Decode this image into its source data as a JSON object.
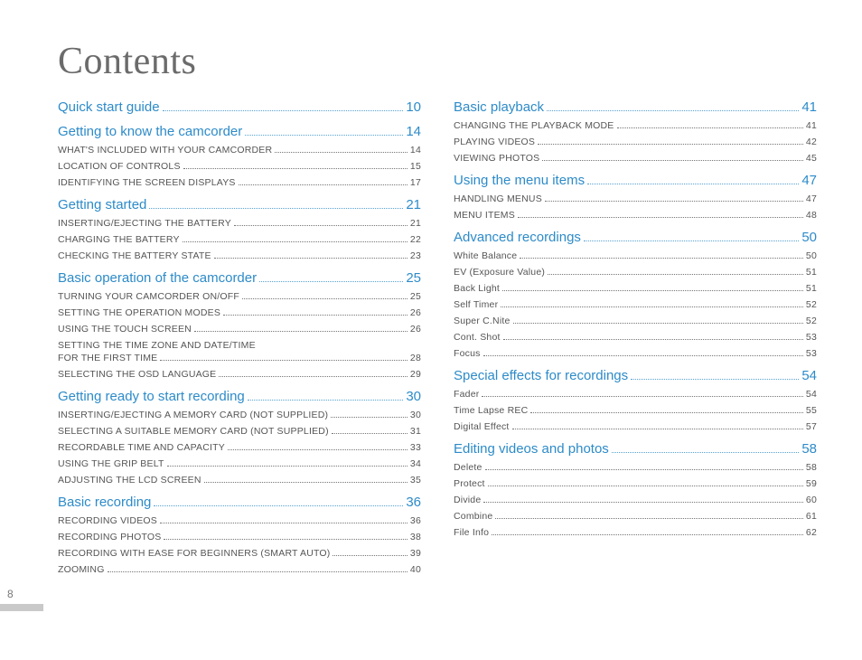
{
  "pageNumber": "8",
  "title": "Contents",
  "columns": [
    [
      {
        "type": "section",
        "label": "Quick start guide",
        "page": "10"
      },
      {
        "type": "section",
        "label": "Getting to know the camcorder",
        "page": "14"
      },
      {
        "type": "item",
        "label": "WHAT'S INCLUDED WITH YOUR CAMCORDER",
        "page": "14"
      },
      {
        "type": "item",
        "label": "LOCATION OF CONTROLS",
        "page": "15"
      },
      {
        "type": "item",
        "label": "IDENTIFYING THE SCREEN DISPLAYS",
        "page": "17"
      },
      {
        "type": "section",
        "label": "Getting started",
        "page": "21"
      },
      {
        "type": "item",
        "label": "INSERTING/EJECTING THE BATTERY",
        "page": "21"
      },
      {
        "type": "item",
        "label": "CHARGING THE BATTERY",
        "page": "22"
      },
      {
        "type": "item",
        "label": "CHECKING THE BATTERY STATE",
        "page": "23"
      },
      {
        "type": "section",
        "label": "Basic operation of the camcorder",
        "page": "25"
      },
      {
        "type": "item",
        "label": "TURNING YOUR CAMCORDER ON/OFF",
        "page": "25"
      },
      {
        "type": "item",
        "label": "SETTING THE OPERATION MODES",
        "page": "26"
      },
      {
        "type": "item",
        "label": "USING THE TOUCH SCREEN",
        "page": "26"
      },
      {
        "type": "item2",
        "label1": "SETTING THE TIME ZONE AND DATE/TIME",
        "label2": "FOR THE FIRST TIME",
        "page": "28"
      },
      {
        "type": "item",
        "label": "SELECTING THE OSD LANGUAGE",
        "page": "29"
      },
      {
        "type": "section",
        "label": "Getting ready to start recording",
        "page": "30"
      },
      {
        "type": "item",
        "label": "INSERTING/EJECTING A MEMORY CARD (NOT SUPPLIED)",
        "page": "30"
      },
      {
        "type": "item",
        "label": "SELECTING A SUITABLE MEMORY CARD (NOT SUPPLIED)",
        "page": "31"
      },
      {
        "type": "item",
        "label": "RECORDABLE TIME AND CAPACITY",
        "page": "33"
      },
      {
        "type": "item",
        "label": "USING THE GRIP BELT",
        "page": "34"
      },
      {
        "type": "item",
        "label": "ADJUSTING THE LCD SCREEN",
        "page": "35"
      },
      {
        "type": "section",
        "label": "Basic recording",
        "page": "36"
      },
      {
        "type": "item",
        "label": "RECORDING VIDEOS",
        "page": "36"
      },
      {
        "type": "item",
        "label": "RECORDING PHOTOS",
        "page": "38"
      },
      {
        "type": "item",
        "label": "RECORDING WITH EASE FOR BEGINNERS (SMART AUTO)",
        "page": "39"
      },
      {
        "type": "item",
        "label": "ZOOMING",
        "page": "40"
      }
    ],
    [
      {
        "type": "section",
        "label": "Basic playback",
        "page": "41"
      },
      {
        "type": "item",
        "label": "CHANGING THE PLAYBACK MODE",
        "page": "41"
      },
      {
        "type": "item",
        "label": "PLAYING VIDEOS",
        "page": "42"
      },
      {
        "type": "item",
        "label": "VIEWING PHOTOS",
        "page": "45"
      },
      {
        "type": "section",
        "label": "Using the menu items",
        "page": "47"
      },
      {
        "type": "item",
        "label": "HANDLING MENUS",
        "page": "47"
      },
      {
        "type": "item",
        "label": "MENU ITEMS",
        "page": "48"
      },
      {
        "type": "section",
        "label": "Advanced recordings",
        "page": "50"
      },
      {
        "type": "itemn",
        "label": "White Balance",
        "page": "50"
      },
      {
        "type": "itemn",
        "label": "EV (Exposure Value)",
        "page": "51"
      },
      {
        "type": "itemn",
        "label": "Back Light",
        "page": "51"
      },
      {
        "type": "itemn",
        "label": "Self Timer",
        "page": "52"
      },
      {
        "type": "itemn",
        "label": "Super C.Nite",
        "page": "52"
      },
      {
        "type": "itemn",
        "label": "Cont. Shot",
        "page": "53"
      },
      {
        "type": "itemn",
        "label": "Focus",
        "page": "53"
      },
      {
        "type": "section",
        "label": "Special effects for recordings",
        "page": "54"
      },
      {
        "type": "itemn",
        "label": "Fader",
        "page": "54"
      },
      {
        "type": "itemn",
        "label": "Time Lapse REC",
        "page": "55"
      },
      {
        "type": "itemn",
        "label": "Digital Effect",
        "page": "57"
      },
      {
        "type": "section",
        "label": "Editing videos and photos",
        "page": "58"
      },
      {
        "type": "itemn",
        "label": "Delete",
        "page": "58"
      },
      {
        "type": "itemn",
        "label": "Protect",
        "page": "59"
      },
      {
        "type": "itemn",
        "label": "Divide",
        "page": "60"
      },
      {
        "type": "itemn",
        "label": "Combine",
        "page": "61"
      },
      {
        "type": "itemn",
        "label": "File Info",
        "page": "62"
      }
    ]
  ]
}
